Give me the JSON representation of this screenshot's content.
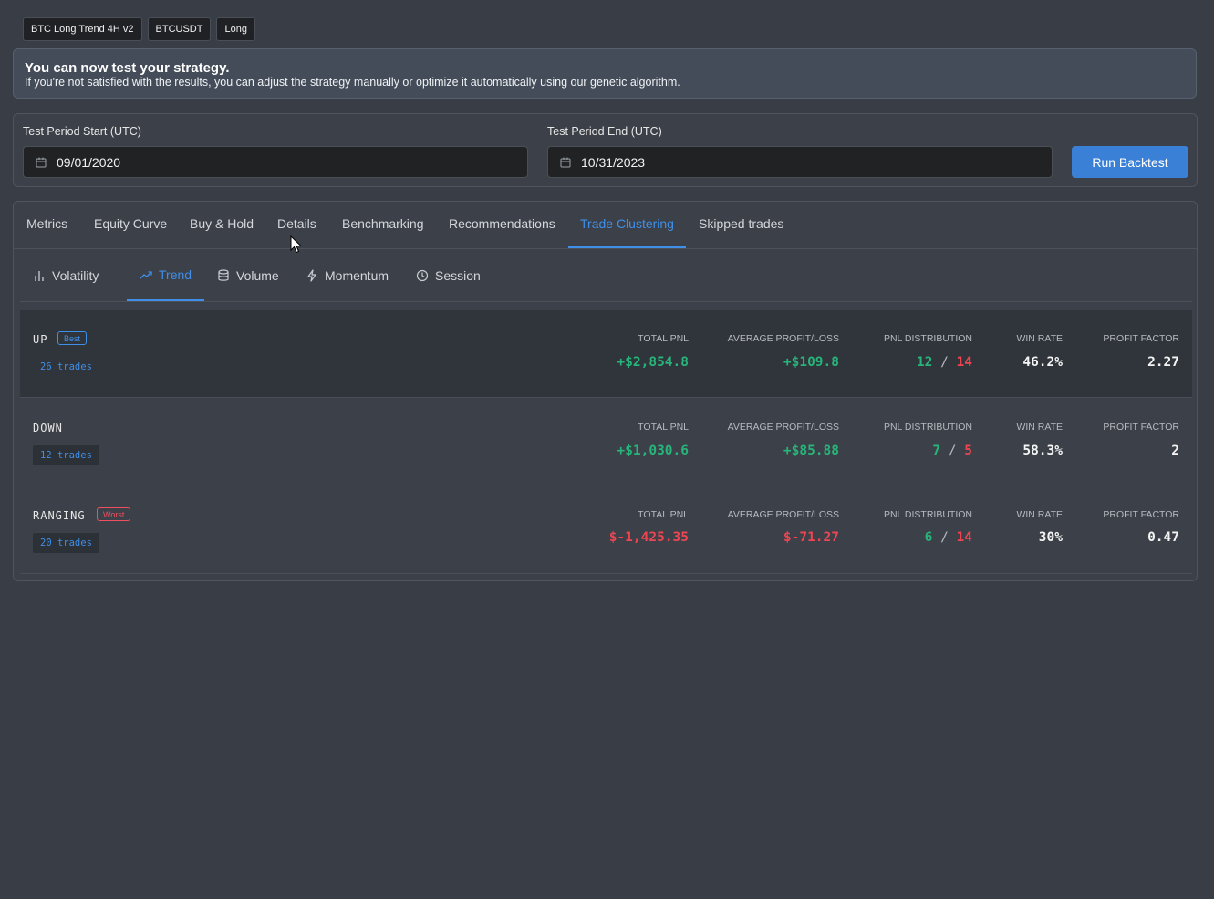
{
  "tags": [
    "BTC Long Trend 4H v2",
    "BTCUSDT",
    "Long"
  ],
  "banner": {
    "title": "You can now test your strategy.",
    "text": "If you're not satisfied with the results, you can adjust the strategy manually or optimize it automatically using our genetic algorithm."
  },
  "period": {
    "start_label": "Test Period Start (UTC)",
    "start_value": "09/01/2020",
    "end_label": "Test Period End (UTC)",
    "end_value": "10/31/2023",
    "run_label": "Run Backtest"
  },
  "tabs": [
    "Metrics",
    "Equity Curve",
    "Buy & Hold",
    "Details",
    "Benchmarking",
    "Recommendations",
    "Trade Clustering",
    "Skipped trades"
  ],
  "active_tab": "Trade Clustering",
  "subtabs": [
    {
      "label": "Volatility",
      "icon": "bar-chart-icon"
    },
    {
      "label": "Trend",
      "icon": "trending-up-icon"
    },
    {
      "label": "Volume",
      "icon": "database-icon"
    },
    {
      "label": "Momentum",
      "icon": "lightning-icon"
    },
    {
      "label": "Session",
      "icon": "clock-icon"
    }
  ],
  "active_subtab": "Trend",
  "metric_labels": {
    "total_pnl": "TOTAL PNL",
    "avg": "AVERAGE PROFIT/LOSS",
    "dist": "PNL DISTRIBUTION",
    "win": "WIN RATE",
    "pf": "PROFIT FACTOR"
  },
  "rows": [
    {
      "name": "UP",
      "badge": "Best",
      "trades": "26 trades",
      "total_pnl": "+$2,854.8",
      "avg": "+$109.8",
      "dist_win": "12",
      "dist_sep": "/",
      "dist_loss": "14",
      "win_rate": "46.2%",
      "profit_factor": "2.27"
    },
    {
      "name": "DOWN",
      "badge": "",
      "trades": "12 trades",
      "total_pnl": "+$1,030.6",
      "avg": "+$85.88",
      "dist_win": "7",
      "dist_sep": "/",
      "dist_loss": "5",
      "win_rate": "58.3%",
      "profit_factor": "2"
    },
    {
      "name": "RANGING",
      "badge": "Worst",
      "trades": "20 trades",
      "total_pnl": "$-1,425.35",
      "avg": "$-71.27",
      "dist_win": "6",
      "dist_sep": "/",
      "dist_loss": "14",
      "win_rate": "30%",
      "profit_factor": "0.47"
    }
  ],
  "colors": {
    "accent": "#3f8fe8",
    "positive": "#27b57a",
    "negative": "#ef4552"
  }
}
